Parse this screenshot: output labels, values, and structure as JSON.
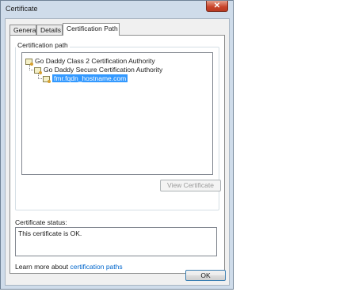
{
  "window": {
    "title": "Certificate",
    "close_glyph": "✕"
  },
  "tabs": [
    {
      "label": "General"
    },
    {
      "label": "Details"
    },
    {
      "label": "Certification Path"
    }
  ],
  "cert_path": {
    "legend": "Certification path",
    "nodes": [
      {
        "label": "Go Daddy Class 2 Certification Authority",
        "icon": "certificate-icon"
      },
      {
        "label": "Go Daddy Secure Certification Authority",
        "icon": "certificate-icon"
      },
      {
        "label": "fmr.fqdn_hostname.com",
        "icon": "certificate-icon",
        "selected": true
      }
    ],
    "view_button": "View Certificate"
  },
  "status": {
    "label": "Certificate status:",
    "text": "This certificate is OK."
  },
  "learn_more": {
    "prefix": "Learn more about ",
    "link": "certification paths"
  },
  "footer": {
    "ok_button": "OK"
  },
  "colors": {
    "selection": "#3399ff",
    "link": "#0066cc",
    "close": "#c8432a"
  }
}
